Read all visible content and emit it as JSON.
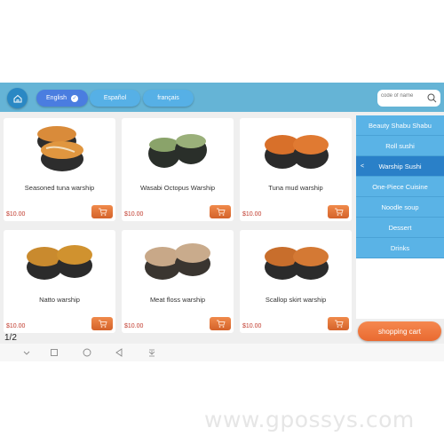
{
  "header": {
    "languages": [
      {
        "label": "English",
        "selected": true
      },
      {
        "label": "Español",
        "selected": false
      },
      {
        "label": "français",
        "selected": false
      }
    ],
    "search": {
      "placeholder": "code of name",
      "value": ""
    }
  },
  "products": [
    {
      "name": "Seasoned tuna warship",
      "price": "$10.00"
    },
    {
      "name": "Wasabi Octopus Warship",
      "price": "$10.00"
    },
    {
      "name": "Tuna mud warship",
      "price": "$10.00"
    },
    {
      "name": "Natto warship",
      "price": "$10.00"
    },
    {
      "name": "Meat floss warship",
      "price": "$10.00"
    },
    {
      "name": "Scallop skirt warship",
      "price": "$10.00"
    }
  ],
  "sidebar": {
    "categories": [
      {
        "label": "Beauty Shabu Shabu",
        "active": false
      },
      {
        "label": "Roll sushi",
        "active": false
      },
      {
        "label": "Warship Sushi",
        "active": true
      },
      {
        "label": "One-Piece Cuisine",
        "active": false
      },
      {
        "label": "Noodle soup",
        "active": false
      },
      {
        "label": "Dessert",
        "active": false
      },
      {
        "label": "Drinks",
        "active": false
      }
    ],
    "active_marker": "<"
  },
  "cart_button": "shopping cart",
  "pager": "1/2",
  "navbar": [
    "chevron-down",
    "square",
    "circle",
    "back-triangle",
    "download"
  ],
  "watermark": "www.gpossys.com",
  "colors": {
    "header": "#65b4d6",
    "accent": "#4a7de0",
    "category": "#5ab3e6",
    "category_active": "#2a80c8",
    "cart": "#e96a31",
    "price": "#c0392b"
  }
}
